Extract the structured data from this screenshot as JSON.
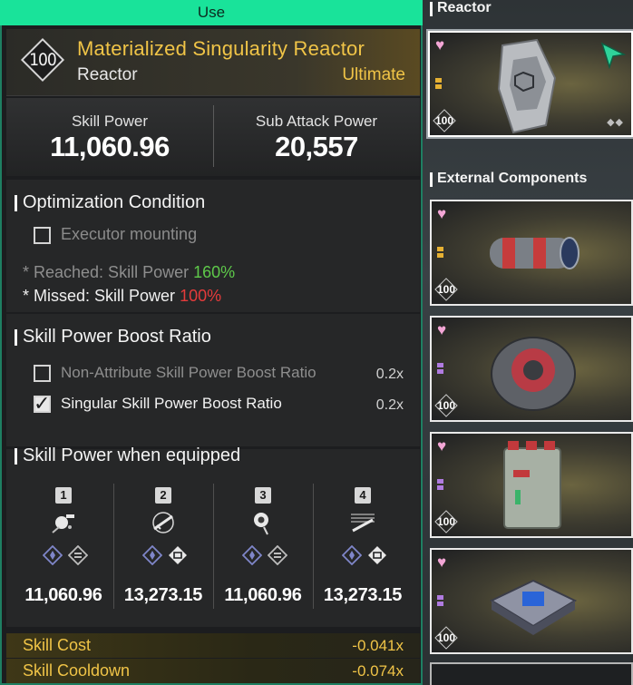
{
  "use_button": {
    "label": "Use"
  },
  "item": {
    "level": "100",
    "name": "Materialized Singularity Reactor",
    "type": "Reactor",
    "grade": "Ultimate"
  },
  "stats": {
    "skill_power_label": "Skill Power",
    "skill_power_value": "11,060.96",
    "sub_attack_label": "Sub Attack Power",
    "sub_attack_value": "20,557"
  },
  "optimization": {
    "title": "Optimization Condition",
    "condition_label": "Executor mounting",
    "reached_prefix": "* Reached: Skill Power ",
    "reached_value": "160%",
    "missed_prefix": "* Missed: Skill Power ",
    "missed_value": "100%"
  },
  "boost_ratio": {
    "title": "Skill Power Boost Ratio",
    "rows": [
      {
        "label": "Non-Attribute Skill Power Boost Ratio",
        "value": "0.2x",
        "checked": false
      },
      {
        "label": "Singular Skill Power Boost Ratio",
        "value": "0.2x",
        "checked": true
      }
    ]
  },
  "equipped": {
    "title": "Skill Power when equipped",
    "slots": [
      {
        "num": "1",
        "icon": "grenade-skill-icon",
        "value": "11,060.96"
      },
      {
        "num": "2",
        "icon": "rifle-skill-icon",
        "value": "13,273.15"
      },
      {
        "num": "3",
        "icon": "orb-skill-icon",
        "value": "11,060.96"
      },
      {
        "num": "4",
        "icon": "shotgun-skill-icon",
        "value": "13,273.15"
      }
    ]
  },
  "footer": {
    "skill_cost_label": "Skill Cost",
    "skill_cost_value": "-0.041x",
    "skill_cooldown_label": "Skill Cooldown",
    "skill_cooldown_value": "-0.074x"
  },
  "right_panel": {
    "reactor_label": "Reactor",
    "external_label": "External Components",
    "cards": [
      {
        "level": "100",
        "kind": "reactor"
      },
      {
        "level": "100",
        "kind": "cylinder"
      },
      {
        "level": "100",
        "kind": "disc"
      },
      {
        "level": "100",
        "kind": "box"
      },
      {
        "level": "100",
        "kind": "plate"
      }
    ]
  },
  "colors": {
    "use_green": "#19e39a",
    "gold": "#f0c447",
    "reached_green": "#5ec94a",
    "missed_red": "#e53b3b"
  }
}
